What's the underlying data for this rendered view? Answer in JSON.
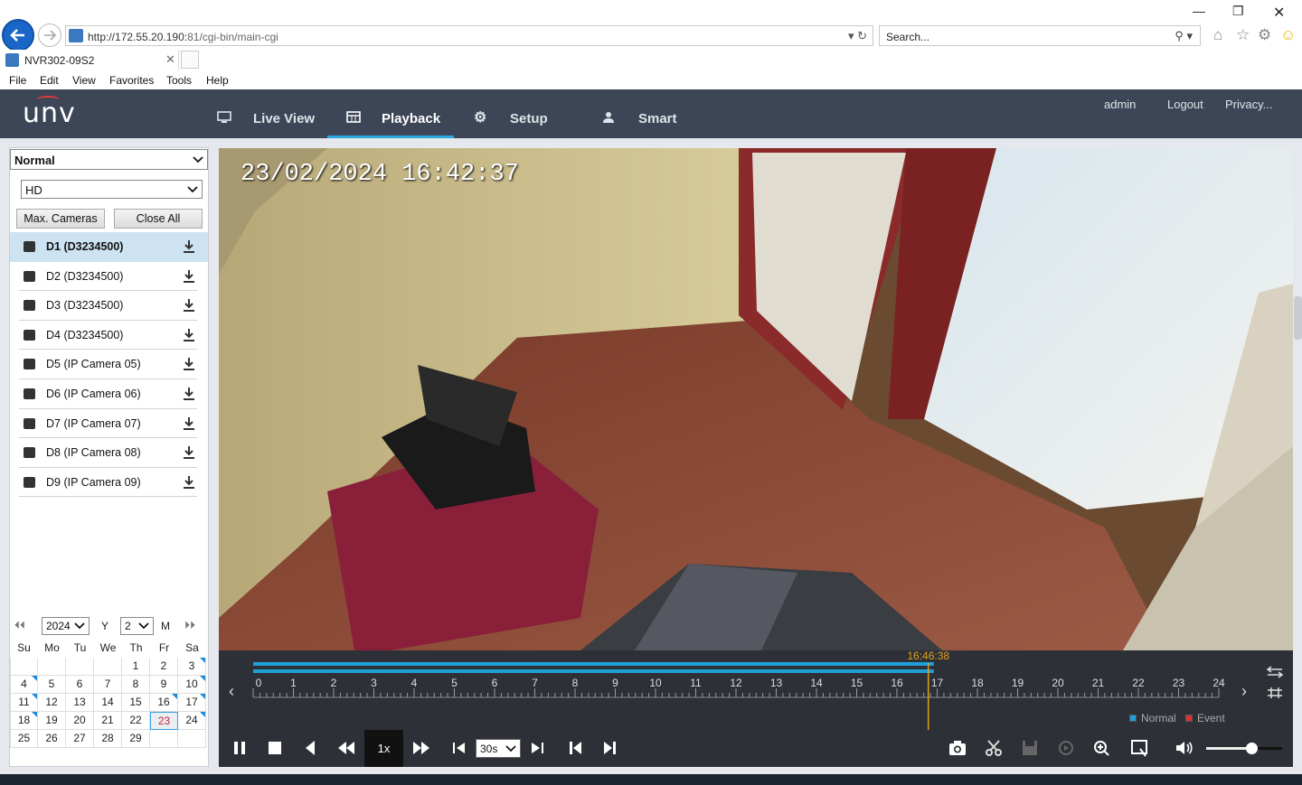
{
  "browser": {
    "url_host": "http://172.55.20.190:",
    "url_path": "81/cgi-bin/main-cgi",
    "search_placeholder": "Search...",
    "tab_title": "NVR302-09S2",
    "menu": [
      "File",
      "Edit",
      "View",
      "Favorites",
      "Tools",
      "Help"
    ]
  },
  "header": {
    "logo": "unv",
    "tabs": [
      {
        "label": "Live View",
        "icon": "monitor-icon"
      },
      {
        "label": "Playback",
        "icon": "calendar-icon",
        "active": true
      },
      {
        "label": "Setup",
        "icon": "gear-icon"
      },
      {
        "label": "Smart",
        "icon": "smart-user-icon"
      }
    ],
    "user": "admin",
    "logout": "Logout",
    "privacy": "Privacy..."
  },
  "sidebar": {
    "mode": "Normal",
    "stream": "HD",
    "max_cameras": "Max. Cameras",
    "close_all": "Close All",
    "cameras": [
      "D1 (D3234500)",
      "D2 (D3234500)",
      "D3 (D3234500)",
      "D4 (D3234500)",
      "D5 (IP Camera 05)",
      "D6 (IP Camera 06)",
      "D7 (IP Camera 07)",
      "D8 (IP Camera 08)",
      "D9 (IP Camera 09)"
    ],
    "selected_camera": 0
  },
  "calendar": {
    "year": "2024",
    "year_label": "Y",
    "month": "2",
    "month_label": "M",
    "weekdays": [
      "Su",
      "Mo",
      "Tu",
      "We",
      "Th",
      "Fr",
      "Sa"
    ],
    "first_weekday": 4,
    "days_in_month": 29,
    "today": 23,
    "record_days": [
      3,
      4,
      10,
      11,
      16,
      17,
      18,
      24
    ]
  },
  "video": {
    "timestamp": "23/02/2024  16:42:37"
  },
  "timeline": {
    "current_time": "16:46:38",
    "current_hour": 16.78,
    "recorded_until_hour": 16.78,
    "hours": [
      "0",
      "1",
      "2",
      "3",
      "4",
      "5",
      "6",
      "7",
      "8",
      "9",
      "10",
      "11",
      "12",
      "13",
      "14",
      "15",
      "16",
      "17",
      "18",
      "19",
      "20",
      "21",
      "22",
      "23",
      "24"
    ],
    "legend_normal": "Normal",
    "legend_event": "Event",
    "colors": {
      "normal": "#1fa0d8",
      "event": "#e03030",
      "cursor": "#e0a020"
    }
  },
  "controls": {
    "speed": "1x",
    "interval": "30s",
    "volume": 0.6
  }
}
